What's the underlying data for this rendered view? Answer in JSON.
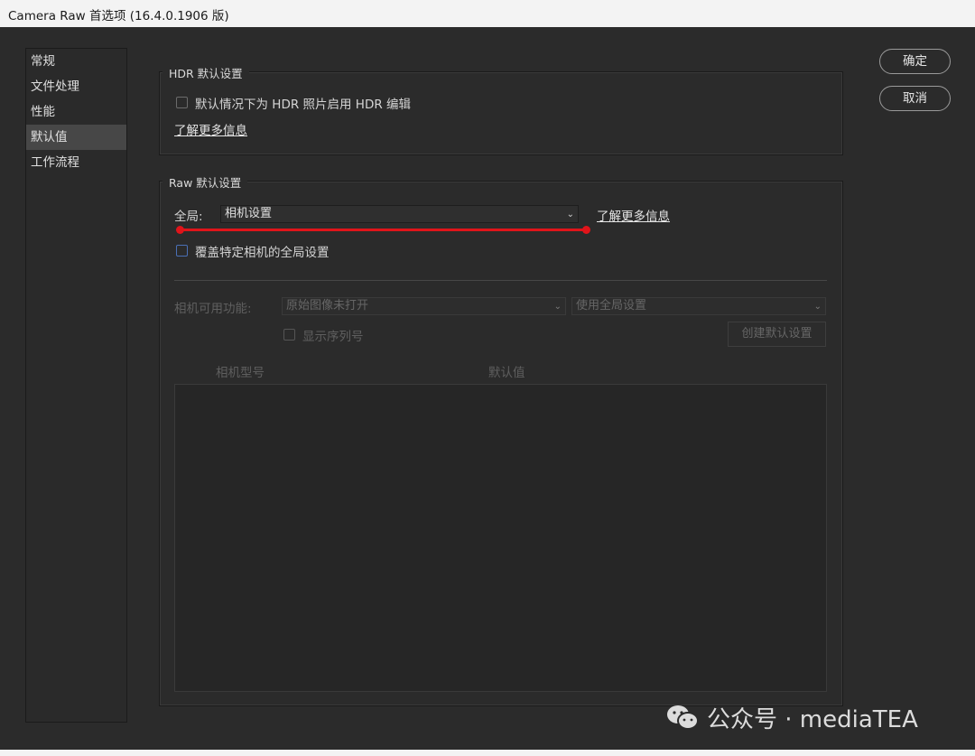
{
  "window": {
    "title": "Camera Raw 首选项 (16.4.0.1906 版)"
  },
  "sidebar": {
    "items": [
      {
        "label": "常规"
      },
      {
        "label": "文件处理"
      },
      {
        "label": "性能"
      },
      {
        "label": "默认值",
        "active": true
      },
      {
        "label": "工作流程"
      }
    ]
  },
  "buttons": {
    "ok": "确定",
    "cancel": "取消"
  },
  "hdr": {
    "legend": "HDR 默认设置",
    "checkbox_label": "默认情况下为 HDR 照片启用 HDR 编辑",
    "checkbox_checked": false,
    "link": "了解更多信息"
  },
  "raw": {
    "legend": "Raw 默认设置",
    "global_label": "全局:",
    "global_value": "相机设置",
    "link": "了解更多信息",
    "override_label": "覆盖特定相机的全局设置",
    "override_checked": false,
    "camera_features_label": "相机可用功能:",
    "camera_select_value": "原始图像未打开",
    "setting_select_value": "使用全局设置",
    "show_serial_label": "显示序列号",
    "create_default_button": "创建默认设置",
    "table_headers": [
      "相机型号",
      "默认值"
    ]
  },
  "watermark": {
    "text": "公众号 · mediaTEA",
    "icon": "wechat-icon"
  },
  "colors": {
    "annotation_red": "#e0141a",
    "background": "#2b2b2b"
  }
}
